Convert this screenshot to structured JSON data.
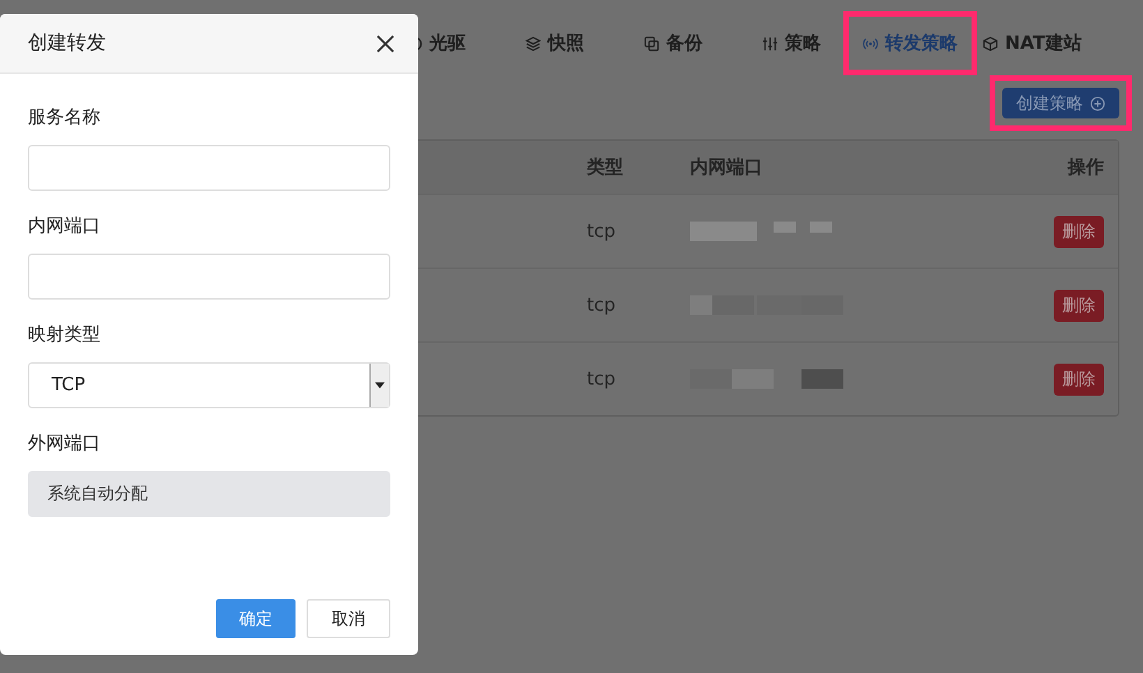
{
  "tabs": [
    {
      "label": "光驱",
      "selected": false,
      "highlighted": false
    },
    {
      "label": "快照",
      "selected": false,
      "highlighted": false
    },
    {
      "label": "备份",
      "selected": false,
      "highlighted": false
    },
    {
      "label": "策略",
      "selected": false,
      "highlighted": false
    },
    {
      "label": "转发策略",
      "selected": true,
      "highlighted": true
    },
    {
      "label": "NAT建站",
      "selected": false,
      "highlighted": false
    }
  ],
  "create_button": {
    "label": "创建策略",
    "highlighted": true
  },
  "table": {
    "columns": [
      "类型",
      "内网端口",
      "操作"
    ],
    "rows": [
      {
        "type": "tcp",
        "action": "删除"
      },
      {
        "type": "tcp",
        "action": "删除"
      },
      {
        "type": "tcp",
        "action": "删除"
      }
    ]
  },
  "dialog": {
    "title": "创建转发",
    "fields": [
      {
        "kind": "text",
        "label": "服务名称"
      },
      {
        "kind": "text",
        "label": "内网端口"
      },
      {
        "kind": "select",
        "label": "映射类型",
        "value": "TCP"
      },
      {
        "kind": "readonly",
        "label": "外网端口",
        "value": "系统自动分配"
      }
    ],
    "buttons": [
      {
        "label": "确定",
        "kind": "primary"
      },
      {
        "label": "取消",
        "kind": "default"
      }
    ]
  }
}
